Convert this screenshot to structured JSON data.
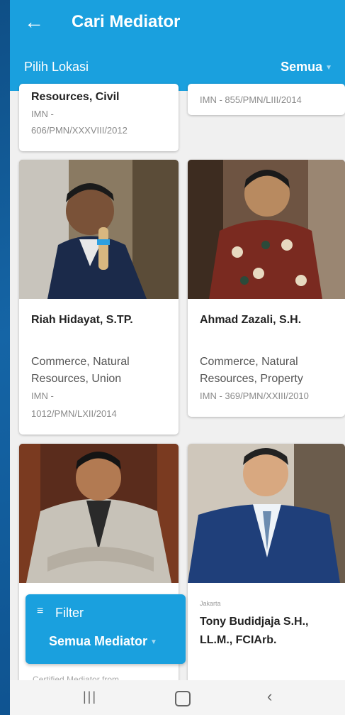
{
  "appbar": {
    "back_icon": "arrow-left-icon",
    "title": "Cari Mediator",
    "location_label": "Pilih Lokasi",
    "location_value": "Semua"
  },
  "cards": [
    {
      "specialty": "Resources, Civil",
      "imn": "IMN - 606/PMN/XXXVIII/2012"
    },
    {
      "imn": "IMN - 855/PMN/LIII/2014"
    },
    {
      "name": "Riah Hidayat, S.TP.",
      "specialty_1": "Commerce, Natural",
      "specialty_2": "Resources, Union",
      "imn_1": "IMN -",
      "imn_2": "1012/PMN/LXII/2014"
    },
    {
      "name": "Ahmad Zazali, S.H.",
      "specialty_1": "Commerce, Natural",
      "specialty_2": "Resources, Property",
      "imn": "IMN - 369/PMN/XXIII/2010"
    },
    {},
    {
      "city": "Jakarta",
      "name_1": "Tony Budidjaja S.H.,",
      "name_2": "LL.M., FCIArb."
    }
  ],
  "filter": {
    "icon": "filter-icon",
    "label": "Filter",
    "value": "Semua Mediator"
  },
  "cutoff_text": "Certified Mediator from",
  "navbar": {
    "recent_icon": "recent-apps-icon",
    "home_icon": "home-icon",
    "back_icon": "back-chevron-icon"
  }
}
